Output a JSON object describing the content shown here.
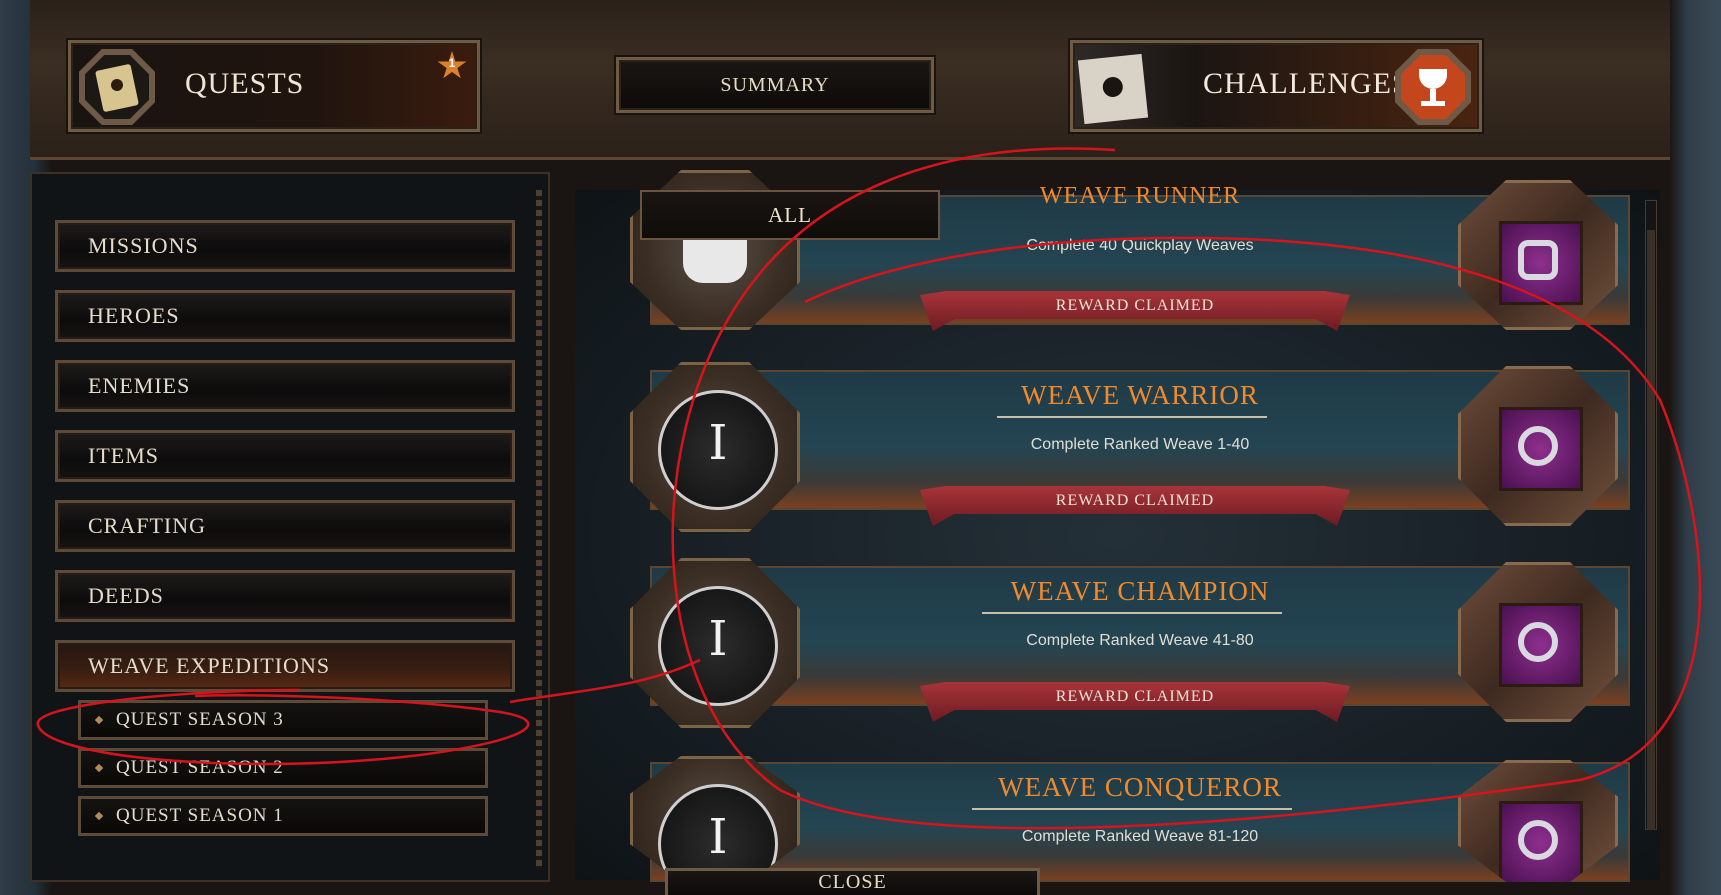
{
  "header": {
    "quests_tab_label": "QUESTS",
    "quests_badge": "1",
    "summary_label": "SUMMARY",
    "challenges_tab_label": "CHALLENGES",
    "filter_label": "ALL",
    "close_label": "CLOSE"
  },
  "sidebar": {
    "items": [
      {
        "label": "MISSIONS"
      },
      {
        "label": "HEROES"
      },
      {
        "label": "ENEMIES"
      },
      {
        "label": "ITEMS"
      },
      {
        "label": "CRAFTING"
      },
      {
        "label": "DEEDS"
      },
      {
        "label": "WEAVE EXPEDITIONS"
      }
    ],
    "subitems": [
      {
        "label": "QUEST SEASON 3"
      },
      {
        "label": "QUEST SEASON 2"
      },
      {
        "label": "QUEST SEASON 1"
      }
    ]
  },
  "challenges": [
    {
      "title": "WEAVE RUNNER",
      "description": "Complete 40 Quickplay Weaves",
      "status": "REWARD CLAIMED"
    },
    {
      "title": "WEAVE WARRIOR",
      "description": "Complete Ranked Weave 1-40",
      "status": "REWARD CLAIMED",
      "medal": "I"
    },
    {
      "title": "WEAVE CHAMPION",
      "description": "Complete Ranked Weave 41-80",
      "status": "REWARD CLAIMED",
      "medal": "I"
    },
    {
      "title": "WEAVE CONQUEROR",
      "description": "Complete Ranked Weave 81-120",
      "medal": "I"
    }
  ],
  "colors": {
    "title_orange": "#f08a2e",
    "ribbon_red": "#a8343a",
    "annotation_red": "#d6141c"
  }
}
